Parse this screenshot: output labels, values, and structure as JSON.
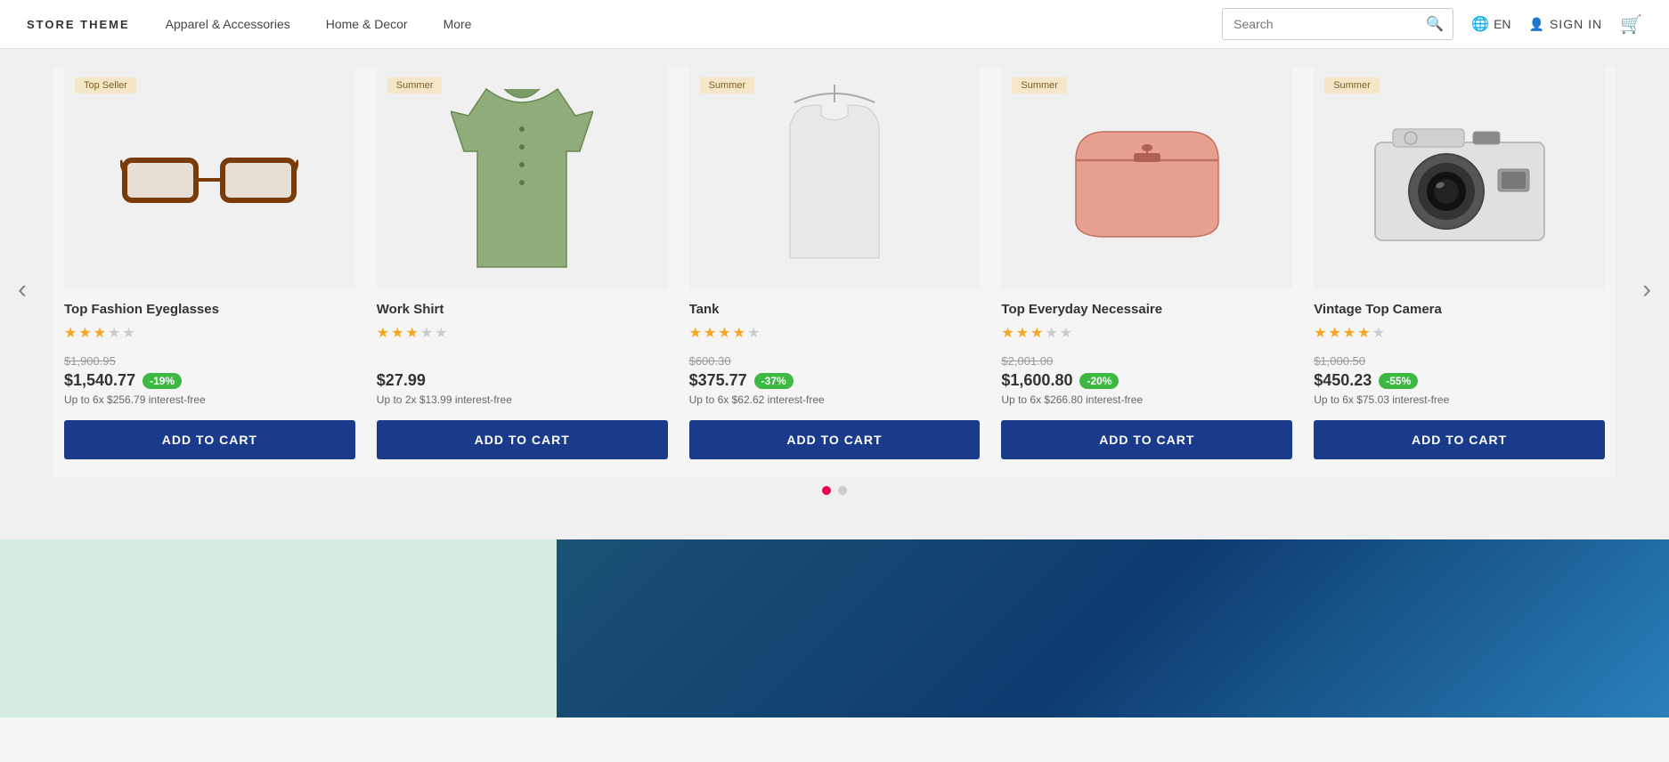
{
  "header": {
    "logo": "STORE THEME",
    "nav": [
      {
        "label": "Apparel & Accessories"
      },
      {
        "label": "Home & Decor"
      },
      {
        "label": "More"
      }
    ],
    "search": {
      "placeholder": "Search",
      "value": ""
    },
    "language": "EN",
    "sign_in": "SIGN IN"
  },
  "carousel": {
    "prev_label": "‹",
    "next_label": "›",
    "dots": [
      {
        "active": true
      },
      {
        "active": false
      }
    ],
    "products": [
      {
        "id": "eyeglasses",
        "badge": "Top Seller",
        "name": "Top Fashion Eyeglasses",
        "stars": [
          true,
          true,
          true,
          false,
          false
        ],
        "original_price": "$1,900.95",
        "current_price": "$1,540.77",
        "discount": "-19%",
        "installment": "Up to 6x $256.79 interest-free",
        "add_to_cart": "ADD TO CART"
      },
      {
        "id": "shirt",
        "badge": "Summer",
        "name": "Work Shirt",
        "stars": [
          true,
          true,
          true,
          false,
          false
        ],
        "original_price": null,
        "current_price": "$27.99",
        "discount": null,
        "installment": "Up to 2x $13.99 interest-free",
        "add_to_cart": "ADD TO CART"
      },
      {
        "id": "tank",
        "badge": "Summer",
        "name": "Tank",
        "stars": [
          true,
          true,
          true,
          true,
          false
        ],
        "original_price": "$600.30",
        "current_price": "$375.77",
        "discount": "-37%",
        "installment": "Up to 6x $62.62 interest-free",
        "add_to_cart": "ADD TO CART"
      },
      {
        "id": "necessaire",
        "badge": "Summer",
        "name": "Top Everyday Necessaire",
        "stars": [
          true,
          true,
          true,
          false,
          false
        ],
        "original_price": "$2,001.00",
        "current_price": "$1,600.80",
        "discount": "-20%",
        "installment": "Up to 6x $266.80 interest-free",
        "add_to_cart": "ADD TO CART"
      },
      {
        "id": "camera",
        "badge": "Summer",
        "name": "Vintage Top Camera",
        "stars": [
          true,
          true,
          true,
          true,
          false
        ],
        "original_price": "$1,000.50",
        "current_price": "$450.23",
        "discount": "-55%",
        "installment": "Up to 6x $75.03 interest-free",
        "add_to_cart": "ADD TO CART"
      }
    ]
  }
}
